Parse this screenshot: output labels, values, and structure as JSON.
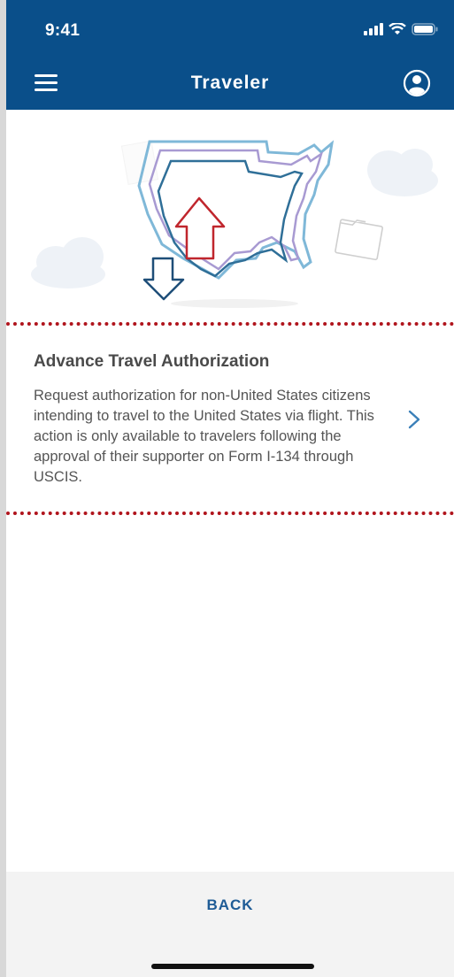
{
  "status_bar": {
    "time": "9:41",
    "signal_icon": "signal-icon",
    "wifi_icon": "wifi-icon",
    "battery_icon": "battery-icon"
  },
  "nav": {
    "title": "Traveler",
    "menu_icon": "hamburger-menu-icon",
    "profile_icon": "user-profile-icon"
  },
  "card": {
    "title": "Advance Travel Authorization",
    "description": "Request authorization for non-United States citizens intending to travel to the United States via flight.  This action is only available to travelers following the approval of their supporter on Form I-134 through USCIS.",
    "chevron_icon": "chevron-right-icon"
  },
  "footer": {
    "back_label": "BACK"
  },
  "colors": {
    "brand": "#0a4f8a",
    "accent_red": "#b0141c",
    "link_blue": "#1f5c96"
  }
}
